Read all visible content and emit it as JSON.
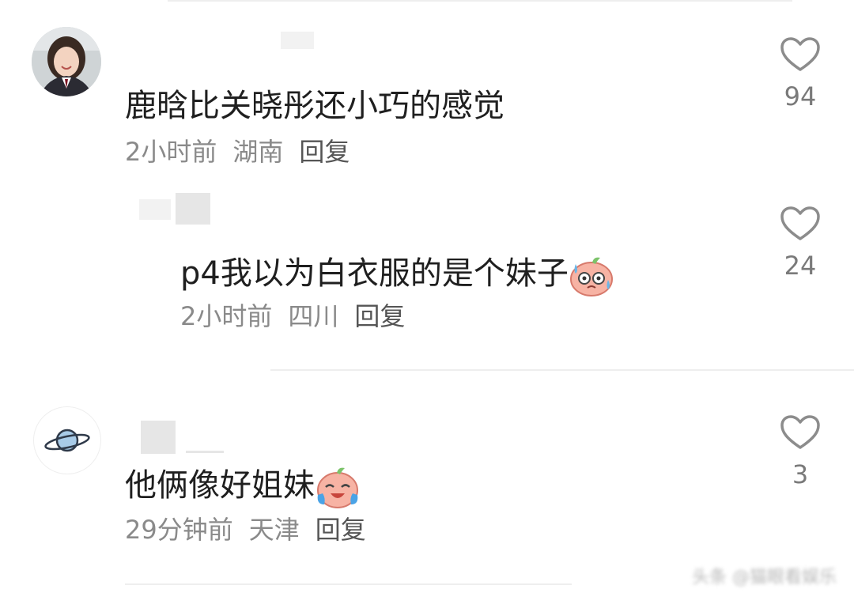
{
  "comments": [
    {
      "text": "鹿晗比关晓彤还小巧的感觉",
      "time": "2小时前",
      "location": "湖南",
      "reply_label": "回复",
      "likes": "94"
    },
    {
      "text": "p4我以为白衣服的是个妹子",
      "time": "2小时前",
      "location": "四川",
      "reply_label": "回复",
      "likes": "24"
    },
    {
      "text": "他俩像好姐妹",
      "time": "29分钟前",
      "location": "天津",
      "reply_label": "回复",
      "likes": "3"
    }
  ],
  "watermark": "头条 @猫眼看娱乐",
  "icons": {
    "like": "heart-outline-icon",
    "emoji_sweat": "nervous-sweat-emoji",
    "emoji_cry": "crying-laugh-emoji",
    "avatar_planet": "planet-icon"
  },
  "colors": {
    "text": "#1f1f1f",
    "meta": "#8a8a8a",
    "icon": "#8c8c8c"
  }
}
